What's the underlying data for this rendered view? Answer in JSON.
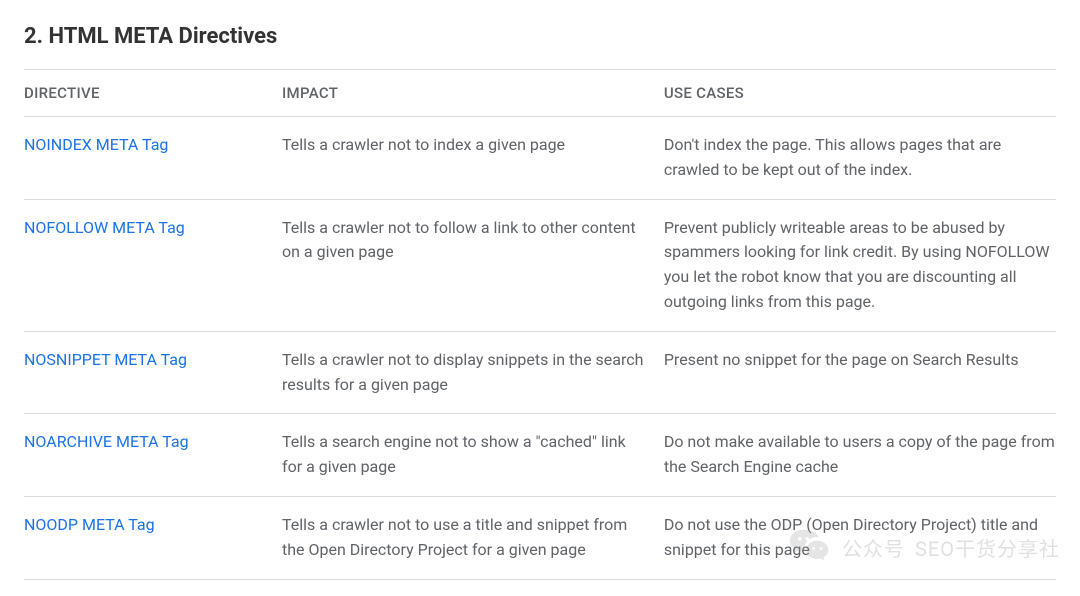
{
  "section_title": "2. HTML META Directives",
  "table": {
    "headers": [
      "DIRECTIVE",
      "IMPACT",
      "USE CASES"
    ],
    "rows": [
      {
        "directive": "NOINDEX META Tag",
        "impact": "Tells a crawler not to index a given page",
        "use_cases": "Don't index the page. This allows pages that are crawled to be kept out of the index."
      },
      {
        "directive": "NOFOLLOW META Tag",
        "impact": "Tells a crawler not to follow a link to other content on a given page",
        "use_cases": "Prevent publicly writeable areas to be abused by spammers looking for link credit. By using NOFOLLOW you let the robot know that you are discounting all outgoing links from this page."
      },
      {
        "directive": "NOSNIPPET META Tag",
        "impact": "Tells a crawler not to display snippets in the search results for a given page",
        "use_cases": "Present no snippet for the page on Search Results"
      },
      {
        "directive": "NOARCHIVE META Tag",
        "impact": "Tells a search engine not to show a \"cached\" link for a given page",
        "use_cases": "Do not make available to users a copy of the page from the Search Engine cache"
      },
      {
        "directive": "NOODP META Tag",
        "impact": "Tells a crawler not to use a title and snippet from the Open Directory Project for a given page",
        "use_cases": "Do not use the ODP (Open Directory Project) title and snippet for this page"
      }
    ]
  },
  "watermark": {
    "label": "公众号",
    "name": "SEO干货分享社"
  }
}
